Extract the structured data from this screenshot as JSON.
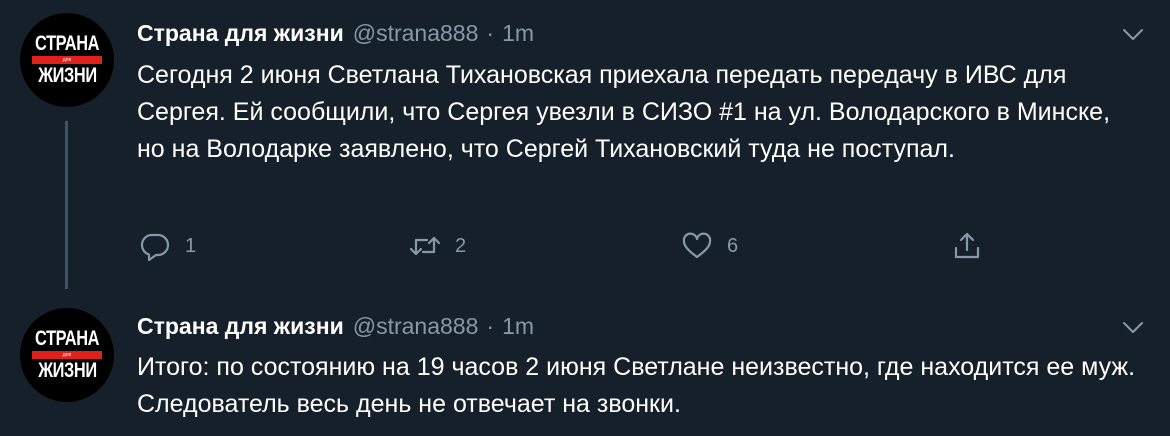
{
  "tweets": [
    {
      "avatar": {
        "top": "СТРАНА",
        "small": "для",
        "bottom": "ЖИЗНИ"
      },
      "name": "Страна для жизни",
      "handle": "@strana888",
      "separator": "·",
      "time": "1m",
      "text": "Сегодня 2 июня Светлана Тихановская приехала передать передачу в ИВС для Сергея. Ей сообщили, что Сергея увезли в СИЗО #1 на ул. Володарского в Минске, но на Володарке заявлено, что Сергей Тихановский туда не поступал.",
      "actions": {
        "replies": "1",
        "retweets": "2",
        "likes": "6"
      }
    },
    {
      "avatar": {
        "top": "СТРАНА",
        "small": "для",
        "bottom": "ЖИЗНИ"
      },
      "name": "Страна для жизни",
      "handle": "@strana888",
      "separator": "·",
      "time": "1m",
      "text": "Итого: по состоянию на 19 часов 2 июня Светлане неизвестно, где находится ее муж. Следователь весь день не отвечает на звонки."
    }
  ],
  "icons": {
    "reply": "reply-icon",
    "retweet": "retweet-icon",
    "like": "heart-icon",
    "share": "share-icon",
    "menu": "chevron-down-icon"
  },
  "colors": {
    "background": "#15202b",
    "text": "#ffffff",
    "secondary": "#8899a6",
    "thread_line": "#3d5466",
    "logo_red": "#e0201b"
  }
}
